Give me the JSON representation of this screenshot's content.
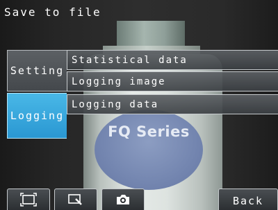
{
  "header": {
    "title": "Save to file"
  },
  "tabs": [
    {
      "label": "Setting",
      "selected": false
    },
    {
      "label": "Logging",
      "selected": true
    }
  ],
  "menu": {
    "items": [
      {
        "label": "Statistical data"
      },
      {
        "label": "Logging image"
      },
      {
        "label": "Logging data"
      }
    ]
  },
  "camera_image": {
    "product_label_text": "FQ Series"
  },
  "toolbar": {
    "icons": [
      "fit-frame-icon",
      "zoom-icon",
      "camera-icon"
    ],
    "back_label": "Back"
  },
  "colors": {
    "selected_tab": "#2a97d2",
    "unselected_tab": "#4a4e52",
    "text": "#ffffff",
    "border": "#c8cccf"
  }
}
